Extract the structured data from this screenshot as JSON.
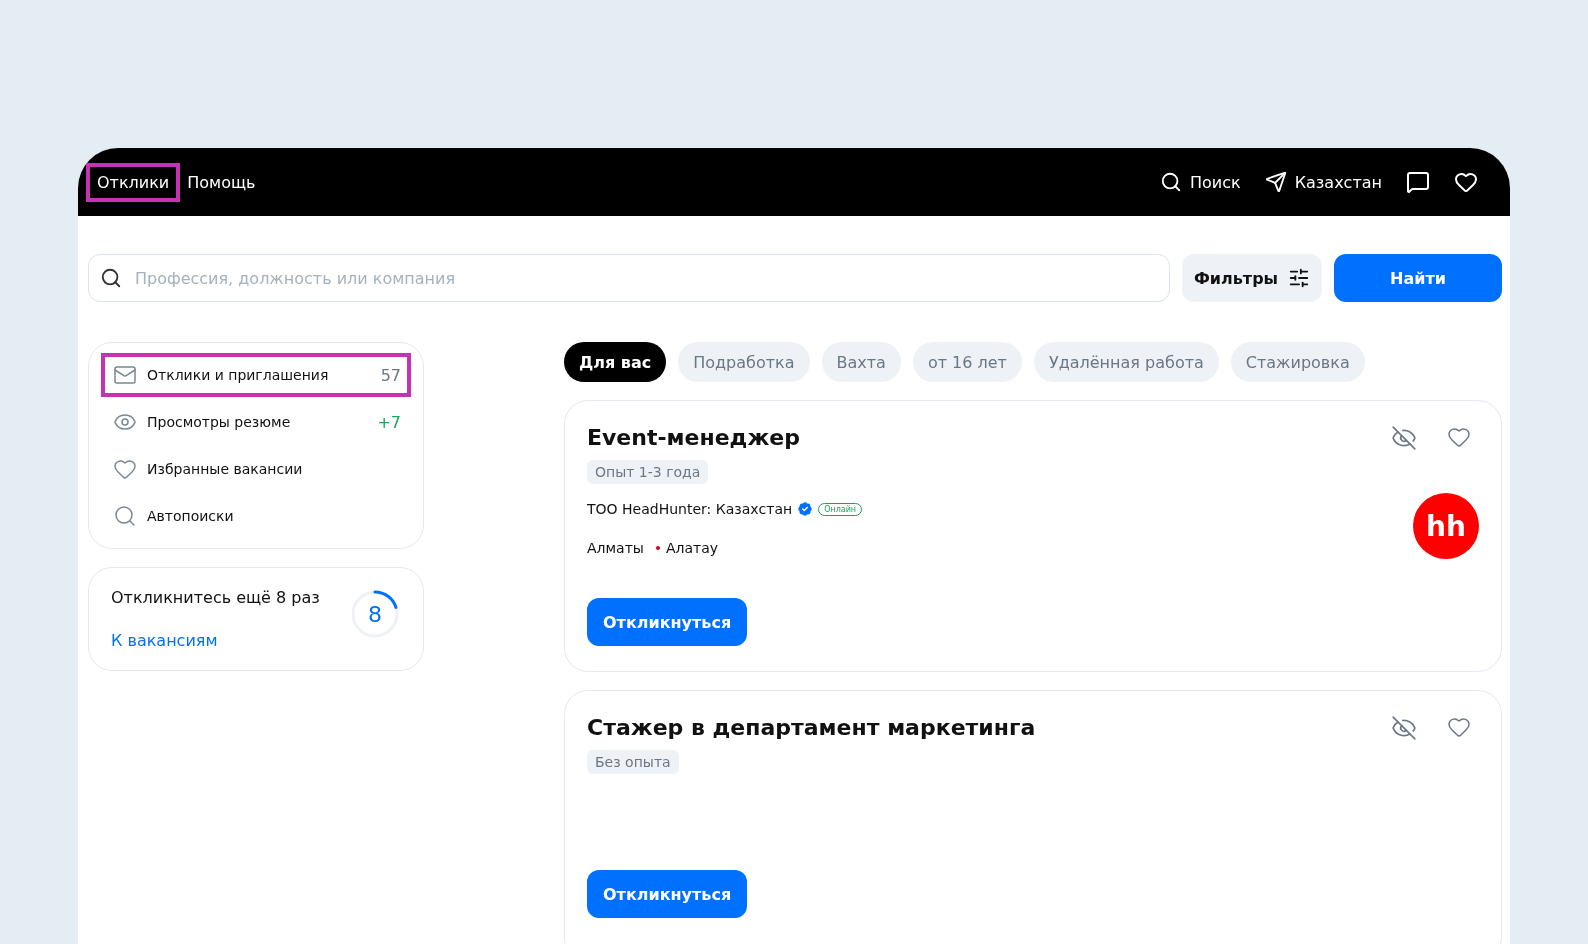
{
  "header": {
    "nav": [
      {
        "label": "Отклики",
        "highlighted": true
      },
      {
        "label": "Помощь",
        "highlighted": false
      }
    ],
    "actions": [
      {
        "kind": "search",
        "label": "Поиск"
      },
      {
        "kind": "location",
        "label": "Казахстан"
      },
      {
        "kind": "chat"
      },
      {
        "kind": "favorites"
      }
    ]
  },
  "search": {
    "placeholder": "Профессия, должность или компания",
    "filters": "Фильтры",
    "submit": "Найти"
  },
  "sidebar": {
    "items": [
      {
        "kind": "mail",
        "label": "Отклики и приглашения",
        "count": "57",
        "color": "#6a7785",
        "highlighted": true
      },
      {
        "kind": "eye",
        "label": "Просмотры резюме",
        "count": "+7",
        "color": "#18a558",
        "highlighted": false
      },
      {
        "kind": "heart",
        "label": "Избранные вакансии",
        "highlighted": false
      },
      {
        "kind": "autosearch",
        "label": "Автопоиски",
        "highlighted": false
      }
    ],
    "progress": {
      "text": "Откликнитесь ещё 8 раз",
      "link": "К вакансиям",
      "number": "8",
      "level": 0.2
    }
  },
  "chips": [
    {
      "label": "Для вас",
      "selected": true
    },
    {
      "label": "Подработка",
      "selected": false
    },
    {
      "label": "Вахта",
      "selected": false
    },
    {
      "label": "от 16 лет",
      "selected": false
    },
    {
      "label": "Удалённая работа",
      "selected": false
    },
    {
      "label": "Стажировка",
      "selected": false
    }
  ],
  "vacancies": [
    {
      "title": "Event-менеджер",
      "experience": "Опыт 1-3 года",
      "company": "ТОО HeadHunter: Казахстан",
      "verified": true,
      "badge": "Онлайн",
      "city": "Алматы",
      "metro": "Алатау",
      "logo": "hh",
      "button": "Откликнуться"
    },
    {
      "title": "Стажер в департамент маркетинга",
      "experience": "Без опыта",
      "button": "Откликнуться"
    }
  ]
}
